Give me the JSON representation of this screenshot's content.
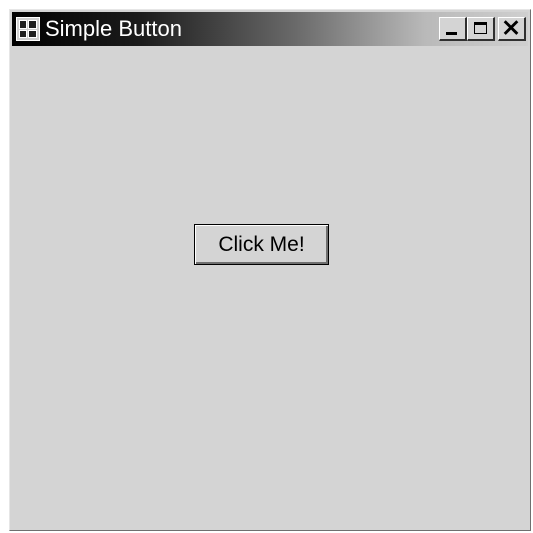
{
  "window": {
    "title": "Simple Button",
    "app_icon": "window-app-icon",
    "caption_buttons": [
      {
        "name": "minimize",
        "icon": "minimize-icon"
      },
      {
        "name": "maximize",
        "icon": "maximize-icon"
      },
      {
        "name": "close",
        "icon": "close-icon"
      }
    ]
  },
  "content": {
    "button_label": "Click Me!"
  },
  "colors": {
    "window_background": "#d4d4d4",
    "titlebar_start": "#000000",
    "titlebar_end": "#cfcfcf",
    "title_text": "#ffffff"
  }
}
